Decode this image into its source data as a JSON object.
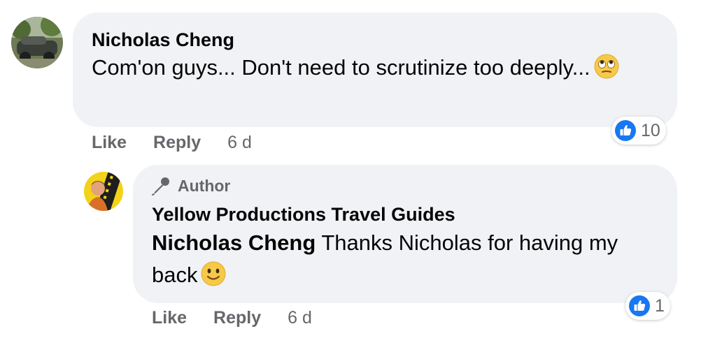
{
  "comments": [
    {
      "author": "Nicholas Cheng",
      "text": "Com'on guys... Don't need to scrutinize too deeply...",
      "emoji": "face-with-rolling-eyes-icon",
      "reaction_count": "10",
      "actions": {
        "like": "Like",
        "reply": "Reply",
        "time": "6 d"
      }
    },
    {
      "badge": "Author",
      "author": "Yellow Productions Travel Guides",
      "mention": "Nicholas Cheng",
      "text": " Thanks Nicholas for having my back",
      "emoji": "slightly-smiling-face-icon",
      "reaction_count": "1",
      "actions": {
        "like": "Like",
        "reply": "Reply",
        "time": "6 d"
      }
    }
  ],
  "colors": {
    "bubble": "#f0f2f5",
    "secondary_text": "#65676b",
    "like_blue": "#1877f2"
  }
}
